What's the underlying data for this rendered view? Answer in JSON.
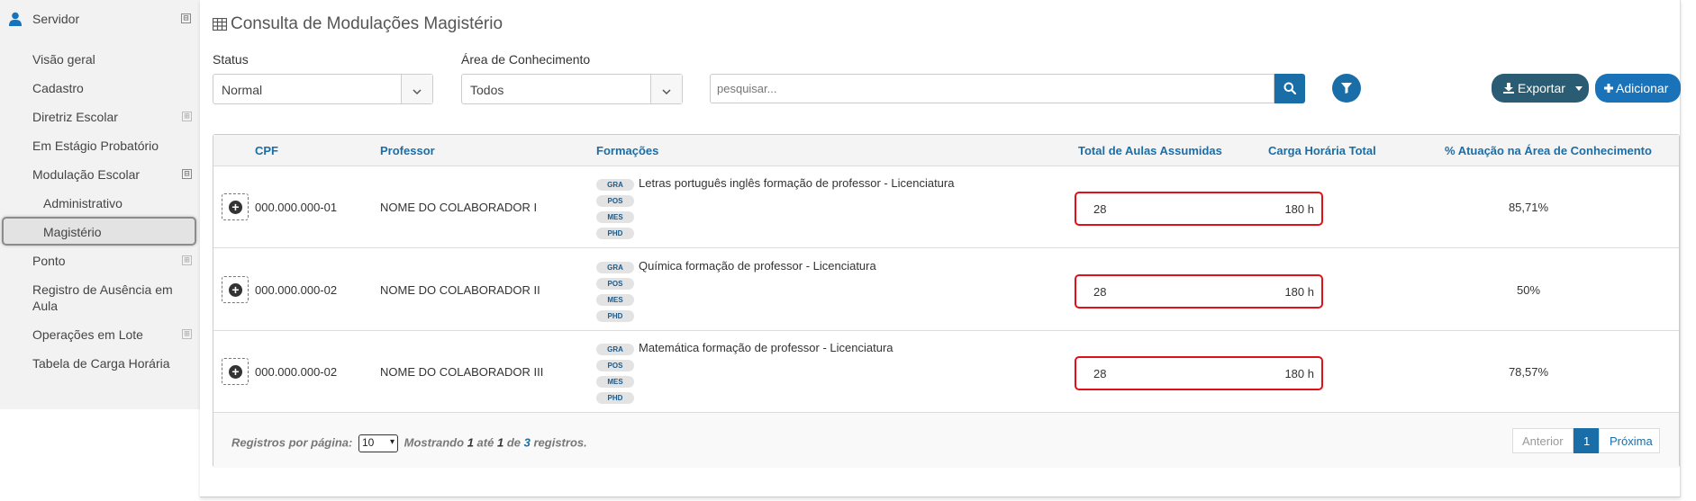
{
  "sidebar": {
    "title": "Servidor",
    "items": [
      {
        "label": "Visão geral"
      },
      {
        "label": "Cadastro"
      },
      {
        "label": "Diretriz Escolar"
      },
      {
        "label": "Em Estágio Probatório"
      },
      {
        "label": "Modulação Escolar"
      },
      {
        "label": "Administrativo"
      },
      {
        "label": "Magistério"
      },
      {
        "label": "Ponto"
      },
      {
        "label": "Registro de Ausência em Aula"
      },
      {
        "label": "Operações em Lote"
      },
      {
        "label": "Tabela de Carga Horária"
      }
    ],
    "toggle_expanded": "⊟",
    "toggle_collapsed": "⊞"
  },
  "page": {
    "title": "Consulta de Modulações Magistério"
  },
  "filters": {
    "status_label": "Status",
    "status_value": "Normal",
    "area_label": "Área de Conhecimento",
    "area_value": "Todos",
    "search_placeholder": "pesquisar..."
  },
  "actions": {
    "export_label": "Exportar",
    "add_label": "Adicionar"
  },
  "table": {
    "headers": {
      "cpf": "CPF",
      "professor": "Professor",
      "formacoes": "Formações",
      "total_aulas": "Total de Aulas Assumidas",
      "carga": "Carga Horária Total",
      "atuacao": "% Atuação na Área de Conhecimento"
    },
    "badges": [
      "GRA",
      "POS",
      "MES",
      "PHD"
    ],
    "rows": [
      {
        "cpf": "000.000.000-01",
        "professor": "NOME DO COLABORADOR I",
        "formacao": "Letras português inglês formação de professor - Licenciatura",
        "total_aulas": "28",
        "carga": "180 h",
        "atuacao": "85,71%"
      },
      {
        "cpf": "000.000.000-02",
        "professor": "NOME DO COLABORADOR II",
        "formacao": "Química formação de professor - Licenciatura",
        "total_aulas": "28",
        "carga": "180 h",
        "atuacao": "50%"
      },
      {
        "cpf": "000.000.000-02",
        "professor": "NOME DO COLABORADOR III",
        "formacao": "Matemática formação de professor - Licenciatura",
        "total_aulas": "28",
        "carga": "180 h",
        "atuacao": "78,57%"
      }
    ]
  },
  "footer": {
    "per_page_label": "Registros por página:",
    "per_page_value": "10",
    "showing": "Mostrando",
    "from": "1",
    "until": "até",
    "to": "1",
    "of": "de",
    "total": "3",
    "records": "registros.",
    "prev": "Anterior",
    "page": "1",
    "next": "Próxima"
  },
  "colors": {
    "primary": "#1a6ea8",
    "export": "#2a5c73",
    "highlight": "#e0101a"
  }
}
